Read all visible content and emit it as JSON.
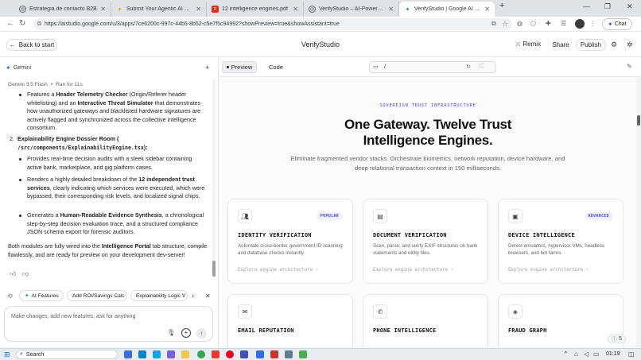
{
  "browser": {
    "tabs": [
      {
        "title": "Estrategia de contacto B2B",
        "icon": "globe-icon"
      },
      {
        "title": "Submit Your Agentic AI Project | Ka",
        "icon": "spark-icon"
      },
      {
        "title": "12 intelligence engines.pdf",
        "icon": "pdf-icon"
      },
      {
        "title": "VerifyStudio – AI-Powered Trust In",
        "icon": "globe-icon"
      },
      {
        "title": "VerifyStudio | Google AI Studio",
        "icon": "aistudio-icon"
      }
    ],
    "url": "https://aistudio.google.com/u/3/apps/7ce6200c-997c-44b5-8b52-c5e7f5c94992?showPreview=true&showAssistant=true",
    "chat_label": "Chat"
  },
  "header": {
    "back_label": "Back to start",
    "title": "VerifyStudio",
    "remix_label": "Remix",
    "share_label": "Share",
    "publish_label": "Publish"
  },
  "assistant": {
    "name": "Gemini",
    "model": "Gemini 3.5 Flash",
    "run_time": "Ran for 11s",
    "item1_text_a": "Features a ",
    "item1_bold_a": "Header Telemetry Checker",
    "item1_text_b": " (Origin/Referer header whitelisting) and an ",
    "item1_bold_b": "Interactive Threat Simulator",
    "item1_text_c": " that demonstrates how unauthorized gateways and blacklisted hardware signatures are actively flagged and synchronized across the collective intelligence consortium.",
    "item2_number": "2.",
    "item2_title": "Explainability Engine Dossier Room (",
    "item2_path": "/src/components/ExplainabilityEngine.tsx",
    "item2_close": "):",
    "b1": "Provides real-time decision audits with a sleek sidebar containing active bank, marketplace, and gig platform cases.",
    "b2_a": "Renders a highly detailed breakdown of the ",
    "b2_bold": "12 independent trust services",
    "b2_b": ", clearly indicating which services were executed, which were bypassed, their corresponding risk levels, and localized signal chips.",
    "b3_a": "Generates a ",
    "b3_bold": "Human-Readable Evidence Synthesis",
    "b3_b": ", a chronological step-by-step decision evaluation trace, and a structured compliance JSON schema export for forensic auditors.",
    "summary_a": "Both modules are fully wired into the ",
    "summary_bold": "Intelligence Portal",
    "summary_b": " tab structure, compile flawlessly, and are ready for preview on your development dev-server!",
    "chips": [
      "AI Features",
      "Add ROI/Savings Calc",
      "Explainability Logic V"
    ],
    "prompt_placeholder": "Make changes, add new features, ask for anything"
  },
  "preview": {
    "tab_preview": "Preview",
    "tab_code": "Code",
    "path": "/",
    "eyebrow": "SOVEREIGN TRUST INFRASTRUCTURE",
    "headline_1": "One Gateway. Twelve Trust",
    "headline_2": "Intelligence Engines.",
    "subtitle": "Eliminate fragmented vendor stacks. Orchestrate biometrics, network reputation, device hardware, and deep relational transaction context in 150 milliseconds.",
    "cards": [
      {
        "title": "IDENTITY VERIFICATION",
        "badge": "POPULAR",
        "desc": "Automate cross-border government ID scanning and database checks instantly.",
        "link": "Explore engine architecture ›",
        "icon": "users-icon"
      },
      {
        "title": "DOCUMENT VERIFICATION",
        "badge": "",
        "desc": "Scan, parse, and verify EXIF structures on bank statements and utility files.",
        "link": "Explore engine architecture ›",
        "icon": "document-icon"
      },
      {
        "title": "DEVICE INTELLIGENCE",
        "badge": "ADVANCED",
        "desc": "Detect emulators, hypervisor VMs, headless browsers, and bot farms.",
        "link": "Explore engine architecture ›",
        "icon": "chip-icon"
      },
      {
        "title": "EMAIL REPUTATION",
        "badge": "",
        "icon": "mail-icon"
      },
      {
        "title": "PHONE INTELLIGENCE",
        "badge": "",
        "icon": "phone-icon"
      },
      {
        "title": "FRAUD GRAPH",
        "badge": "",
        "icon": "layers-icon"
      }
    ],
    "notification_count": "5"
  },
  "taskbar": {
    "search_label": "Search",
    "time": "01:19"
  },
  "colors": {
    "accent": "#4f46e5",
    "tab_strip": "#dfe3e8",
    "publish_border": "#dadce0"
  }
}
